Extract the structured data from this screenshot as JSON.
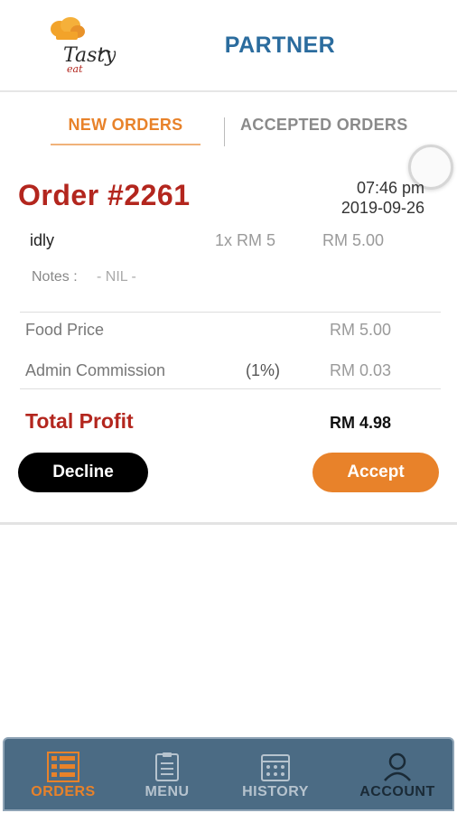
{
  "header": {
    "logo_text_main": "Tasty",
    "logo_text_sub": "eat",
    "title": "PARTNER"
  },
  "tabs": {
    "new_orders": "NEW ORDERS",
    "accepted_orders": "ACCEPTED ORDERS"
  },
  "order": {
    "number": "Order #2261",
    "time": "07:46 pm",
    "date": "2019-09-26",
    "items": [
      {
        "name": "idly",
        "qty": "1x RM 5",
        "price": "RM 5.00"
      }
    ],
    "notes_label": "Notes :",
    "notes_value": "- NIL -",
    "food_price_label": "Food Price",
    "food_price_value": "RM 5.00",
    "admin_commission_label": "Admin Commission",
    "admin_commission_pct": "(1%)",
    "admin_commission_value": "RM 0.03",
    "total_profit_label": "Total Profit",
    "total_profit_value": "RM 4.98"
  },
  "actions": {
    "decline_label": "Decline",
    "accept_label": "Accept"
  },
  "bottom_nav": {
    "items": [
      {
        "label": "ORDERS",
        "icon": "orders-list-icon",
        "active": true
      },
      {
        "label": "MENU",
        "icon": "menu-clipboard-icon",
        "active": false
      },
      {
        "label": "HISTORY",
        "icon": "history-calendar-icon",
        "active": false
      },
      {
        "label": "ACCOUNT",
        "icon": "account-user-icon",
        "active": false
      }
    ]
  },
  "colors": {
    "brand_blue": "#2b6c9e",
    "accent_orange": "#e8822a",
    "order_red": "#b3261e",
    "nav_bg": "#4b6b84"
  }
}
